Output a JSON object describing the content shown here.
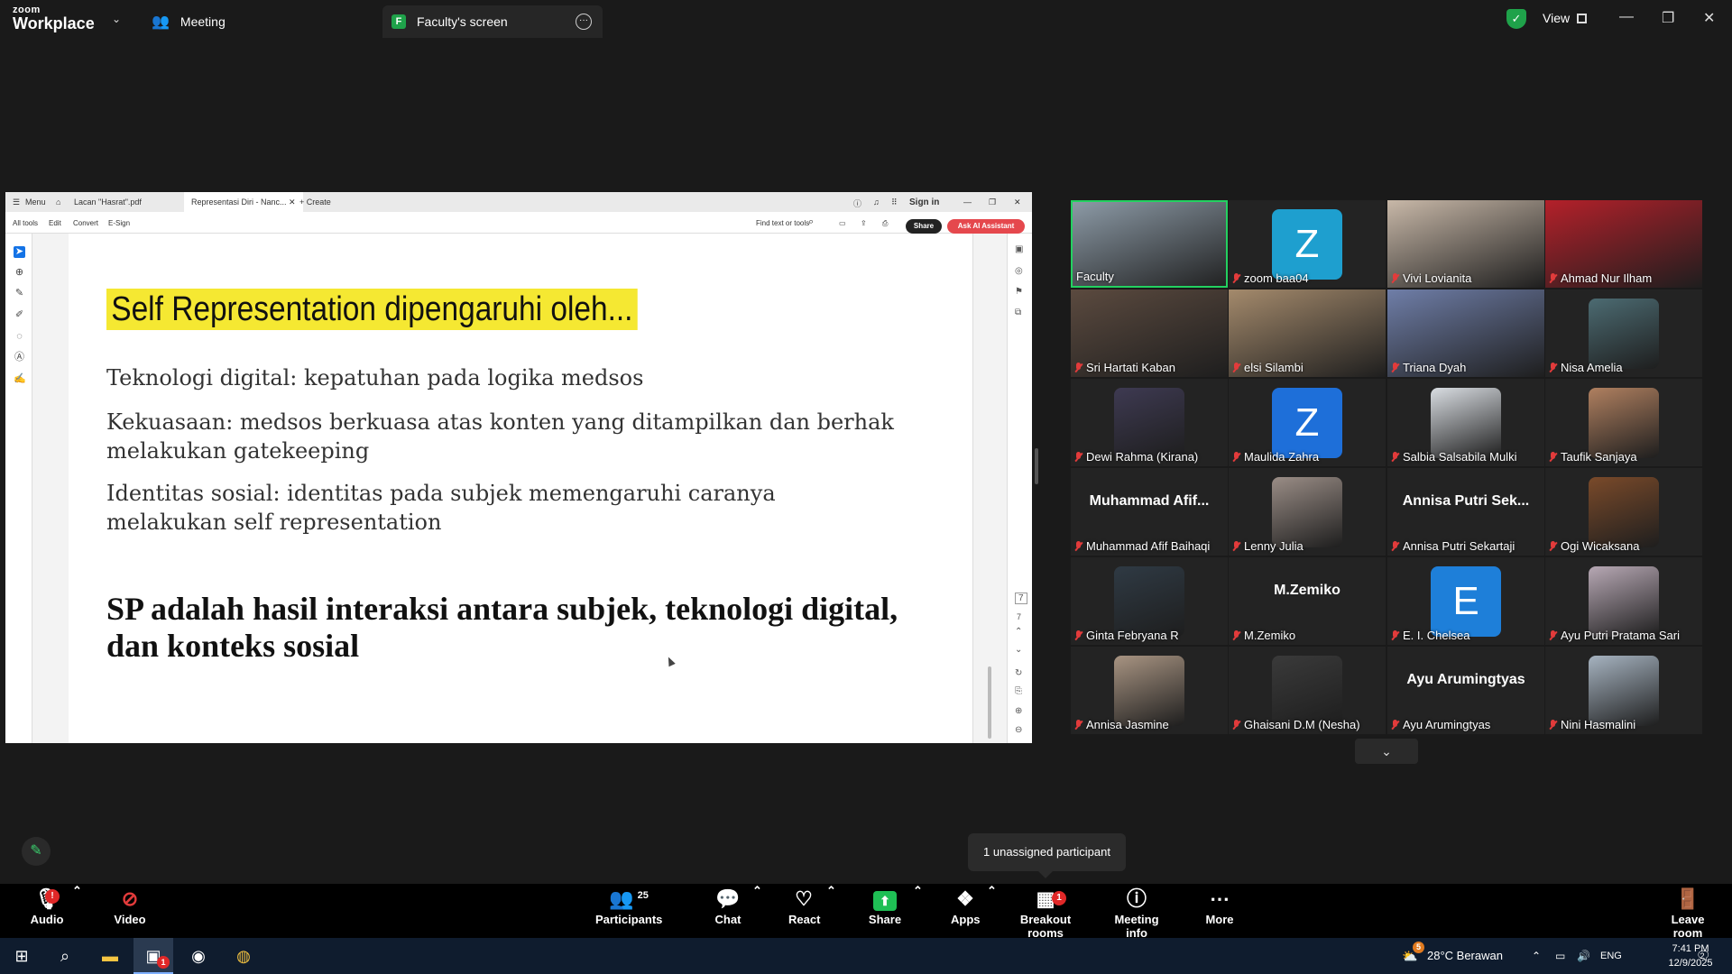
{
  "window": {
    "brand_line1": "zoom",
    "brand_line2": "Workplace",
    "tab_meeting": "Meeting",
    "tab_screen": "Faculty's screen",
    "tab_screen_letter": "F",
    "view_label": "View"
  },
  "pdf": {
    "tabs": {
      "menu": "Menu",
      "file1": "Lacan \"Hasrat\".pdf",
      "file2": "Representasi Diri - Nanc...",
      "create": "Create",
      "signin": "Sign in"
    },
    "toolbar": {
      "all_tools": "All tools",
      "edit": "Edit",
      "convert": "Convert",
      "esign": "E-Sign",
      "find": "Find text or tools",
      "share": "Share",
      "ai": "Ask AI Assistant"
    },
    "page_numbers": [
      "7",
      "7"
    ],
    "slide": {
      "title": "Self Representation dipengaruhi oleh...",
      "line1": "Teknologi digital: kepatuhan pada logika medsos",
      "line2": "Kekuasaan: medsos berkuasa atas konten yang ditampilkan dan berhak melakukan gatekeeping",
      "line3": "Identitas sosial: identitas pada subjek memengaruhi caranya melakukan self representation",
      "bold": "SP adalah hasil interaksi antara subjek, teknologi digital, dan konteks sosial"
    }
  },
  "gallery": {
    "tiles": [
      {
        "name": "Faculty",
        "kind": "photo",
        "color": "#8c9aa6",
        "muted": false,
        "active": true
      },
      {
        "name": "zoom baa04",
        "kind": "letter",
        "letter": "Z",
        "color": "#1e9fcf",
        "muted": true
      },
      {
        "name": "Vivi Lovianita",
        "kind": "photo",
        "color": "#c8b8a8",
        "muted": true
      },
      {
        "name": "Ahmad Nur Ilham",
        "kind": "photo",
        "color": "#b4202a",
        "muted": true
      },
      {
        "name": "Sri Hartati Kaban",
        "kind": "photo",
        "color": "#5b4a3f",
        "muted": true
      },
      {
        "name": "elsi Silambi",
        "kind": "photo",
        "color": "#a48a6c",
        "muted": true
      },
      {
        "name": "Triana Dyah",
        "kind": "photo",
        "color": "#6f7ea8",
        "muted": true
      },
      {
        "name": "Nisa Amelia",
        "kind": "photo",
        "color": "#4c6b72",
        "muted": true
      },
      {
        "name": "Dewi Rahma (Kirana)",
        "kind": "photo",
        "color": "#3e3a52",
        "muted": true
      },
      {
        "name": "Maulida Zahra",
        "kind": "letter",
        "letter": "Z",
        "color": "#1e6fd9",
        "muted": true
      },
      {
        "name": "Salbia Salsabila Mulki",
        "kind": "photo",
        "color": "#d9dde2",
        "muted": true
      },
      {
        "name": "Taufik Sanjaya",
        "kind": "photo",
        "color": "#b08060",
        "muted": true
      },
      {
        "name": "Muhammad Afif Baihaqi",
        "kind": "name",
        "display": "Muhammad Afif...",
        "muted": true
      },
      {
        "name": "Lenny Julia",
        "kind": "photo",
        "color": "#9a8d86",
        "muted": true
      },
      {
        "name": "Annisa Putri Sekartaji",
        "kind": "name",
        "display": "Annisa Putri Sek...",
        "muted": true
      },
      {
        "name": "Ogi Wicaksana",
        "kind": "photo",
        "color": "#7a4a2a",
        "muted": true
      },
      {
        "name": "Ginta Febryana R",
        "kind": "photo",
        "color": "#2f3a44",
        "muted": true
      },
      {
        "name": "M.Zemiko",
        "kind": "name",
        "display": "M.Zemiko",
        "muted": true
      },
      {
        "name": "E. I. Chelsea",
        "kind": "letter",
        "letter": "E",
        "color": "#1e7fd9",
        "muted": true
      },
      {
        "name": "Ayu Putri Pratama Sari",
        "kind": "photo",
        "color": "#b7a8b4",
        "muted": true
      },
      {
        "name": "Annisa Jasmine",
        "kind": "photo",
        "color": "#a89482",
        "muted": true
      },
      {
        "name": "Ghaisani D.M (Nesha)",
        "kind": "photo",
        "color": "#3a3a3a",
        "muted": true
      },
      {
        "name": "Ayu Arumingtyas",
        "kind": "name",
        "display": "Ayu Arumingtyas",
        "muted": true
      },
      {
        "name": "Nini Hasmalini",
        "kind": "photo",
        "color": "#a6b3c0",
        "muted": true
      }
    ]
  },
  "unassigned": "1 unassigned participant",
  "toolbar": {
    "audio": "Audio",
    "video": "Video",
    "participants": "Participants",
    "participants_count": "25",
    "chat": "Chat",
    "react": "React",
    "share": "Share",
    "apps": "Apps",
    "breakout": "Breakout rooms",
    "breakout_badge": "1",
    "info": "Meeting info",
    "more": "More",
    "leave": "Leave room",
    "audio_badge": "!"
  },
  "taskbar": {
    "zoom_badge": "1",
    "weather": "28°C Berawan",
    "weather_badge": "5",
    "lang": "ENG",
    "time": "7:41 PM",
    "date": "12/9/2025",
    "notif_count": "2"
  }
}
